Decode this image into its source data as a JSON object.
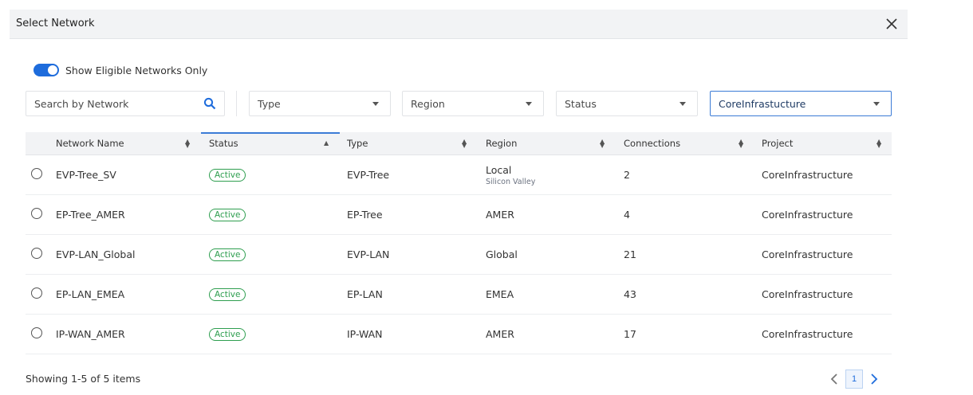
{
  "dialog": {
    "title": "Select Network"
  },
  "toggle": {
    "label": "Show Eligible Networks Only",
    "on": true
  },
  "filters": {
    "search_placeholder": "Search by Network",
    "type": "Type",
    "region": "Region",
    "status": "Status",
    "project": "CoreInfrastucture"
  },
  "table": {
    "columns": [
      "Network Name",
      "Status",
      "Type",
      "Region",
      "Connections",
      "Project"
    ],
    "rows": [
      {
        "name": "EVP-Tree_SV",
        "status": "Active",
        "type": "EVP-Tree",
        "region": "Local",
        "region_sub": "Silicon Valley",
        "connections": "2",
        "project": "CoreInfrastructure"
      },
      {
        "name": "EP-Tree_AMER",
        "status": "Active",
        "type": "EP-Tree",
        "region": "AMER",
        "region_sub": "",
        "connections": "4",
        "project": "CoreInfrastructure"
      },
      {
        "name": "EVP-LAN_Global",
        "status": "Active",
        "type": "EVP-LAN",
        "region": "Global",
        "region_sub": "",
        "connections": "21",
        "project": "CoreInfrastructure"
      },
      {
        "name": "EP-LAN_EMEA",
        "status": "Active",
        "type": "EP-LAN",
        "region": "EMEA",
        "region_sub": "",
        "connections": "43",
        "project": "CoreInfrastructure"
      },
      {
        "name": "IP-WAN_AMER",
        "status": "Active",
        "type": "IP-WAN",
        "region": "AMER",
        "region_sub": "",
        "connections": "17",
        "project": "CoreInfrastructure"
      }
    ]
  },
  "footer": {
    "showing": "Showing 1-5 of 5 items",
    "page": "1"
  },
  "colors": {
    "accent": "#1e6cdc",
    "active_green": "#2e9e4f"
  }
}
